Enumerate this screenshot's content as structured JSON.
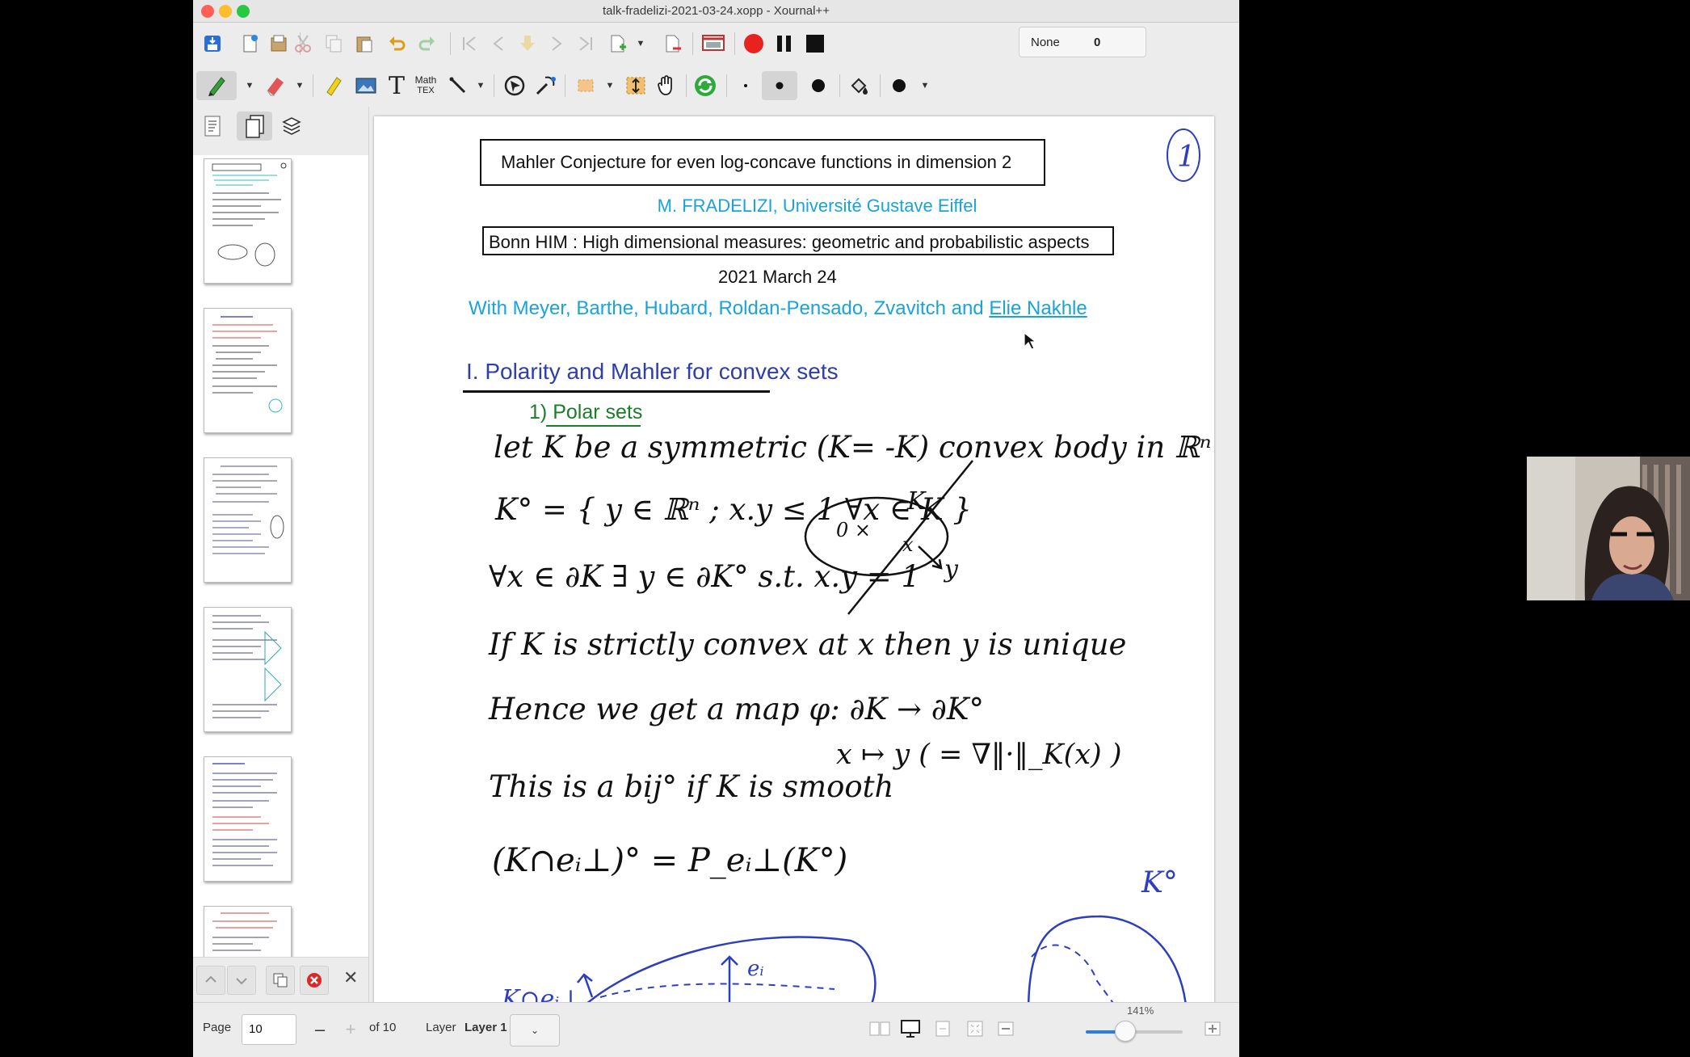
{
  "window": {
    "title": "talk-fradelizi-2021-03-24.xopp - Xournal++"
  },
  "toolbar1": {
    "colors": {
      "record": "#e8231f",
      "stop": "#111111"
    },
    "select": {
      "value": "None",
      "count": "0"
    }
  },
  "toolbar2": {
    "math_label_top": "Math",
    "math_label_bottom": "TEX",
    "text_tool_label": "T"
  },
  "page": {
    "title": "Mahler Conjecture for even log-concave functions in dimension 2",
    "author": "M. FRADELIZI, Université Gustave Eiffel",
    "event": "Bonn HIM : High dimensional measures: geometric and probabilistic aspects",
    "date": "2021 March 24",
    "coauthors_prefix": "With Meyer, Barthe, Hubard, Roldan-Pensado, Zvavitch and ",
    "coauthors_link": "Elie Nakhle",
    "section": "I. Polarity and Mahler for convex sets",
    "subsection_number": "1) ",
    "subsection_title": "Polar sets",
    "page_mark": "1",
    "colors": {
      "title_cyan": "#1aa3d9",
      "section_blue": "#2f3fa8",
      "subsection_green": "#1b7d2a",
      "ink_blue": "#2d3fbf"
    },
    "handwriting": {
      "l1": "let K be a symmetric (K= -K) convex body in ℝⁿ",
      "l2": "K° = { y ∈ ℝⁿ ; x.y ≤ 1  ∀x ∈ K }",
      "l3": "∀x ∈ ∂K  ∃ y ∈ ∂K° s.t.  x.y = 1",
      "l4": "If K is strictly convex at x then y is unique",
      "l5": "Hence we get a map φ: ∂K → ∂K°",
      "l6": "x ↦ y  ( = ∇‖·‖_K(x) )",
      "l7": "This is a bij° if K is smooth",
      "l8": "(K∩eᵢ⊥)° = P_eᵢ⊥(K°)",
      "fig_K": "K",
      "fig_0x": "0 ×",
      "fig_x": "x",
      "fig_y": "y",
      "fig2_ei": "eᵢ",
      "fig2_label": "K∩eᵢ⊥",
      "fig2_Kpolar": "K°"
    }
  },
  "statusbar": {
    "page_label": "Page",
    "page_value": "10",
    "minus": "–",
    "plus": "+",
    "of_label": "of 10",
    "layer_label": "Layer",
    "layer_value": "Layer 1",
    "zoom": "141%",
    "zoom_level": 0.41
  }
}
